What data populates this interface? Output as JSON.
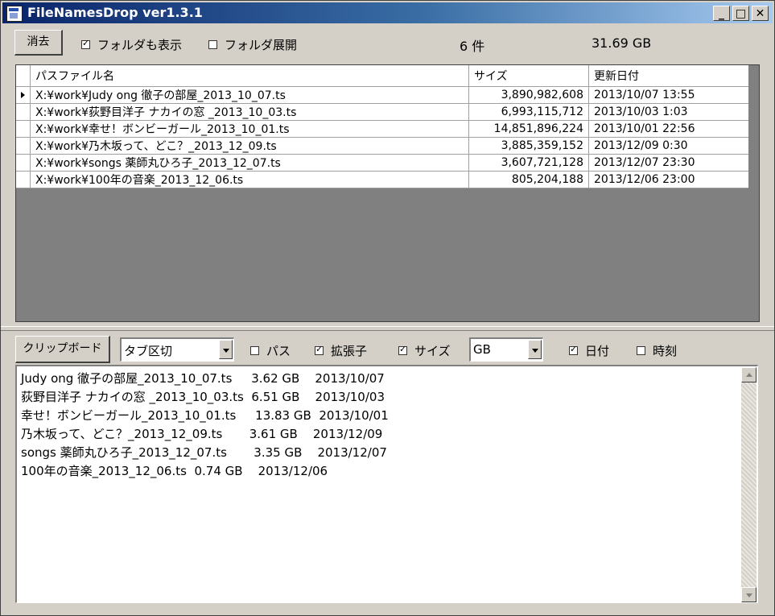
{
  "window": {
    "title": "FileNamesDrop ver1.3.1",
    "minimize": "_",
    "maximize": "□",
    "close": "✕"
  },
  "toolbar": {
    "clear_label": "消去",
    "show_folders_label": "フォルダも表示",
    "show_folders_checked": true,
    "expand_folders_label": "フォルダ展開",
    "expand_folders_checked": false,
    "count": "6 件",
    "total_size": "31.69 GB"
  },
  "grid": {
    "columns": [
      "パスファイル名",
      "サイズ",
      "更新日付"
    ],
    "rows": [
      {
        "path": "X:¥work¥Judy ong 徹子の部屋_2013_10_07.ts",
        "size": "3,890,982,608",
        "date": "2013/10/07 13:55",
        "current": true
      },
      {
        "path": "X:¥work¥荻野目洋子 ナカイの窓 _2013_10_03.ts",
        "size": "6,993,115,712",
        "date": "2013/10/03 1:03",
        "current": false
      },
      {
        "path": "X:¥work¥幸せ！ボンビーガール_2013_10_01.ts",
        "size": "14,851,896,224",
        "date": "2013/10/01 22:56",
        "current": false
      },
      {
        "path": "X:¥work¥乃木坂って、どこ？_2013_12_09.ts",
        "size": "3,885,359,152",
        "date": "2013/12/09 0:30",
        "current": false
      },
      {
        "path": "X:¥work¥songs 薬師丸ひろ子_2013_12_07.ts",
        "size": "3,607,721,128",
        "date": "2013/12/07 23:30",
        "current": false
      },
      {
        "path": "X:¥work¥100年の音楽_2013_12_06.ts",
        "size": "805,204,188",
        "date": "2013/12/06 23:00",
        "current": false
      }
    ]
  },
  "options": {
    "clipboard_label": "クリップボード",
    "separator_value": "タブ区切",
    "path_label": "パス",
    "path_checked": false,
    "ext_label": "拡張子",
    "ext_checked": true,
    "size_label": "サイズ",
    "size_checked": true,
    "unit_value": "GB",
    "date_label": "日付",
    "date_checked": true,
    "time_label": "時刻",
    "time_checked": false
  },
  "output": {
    "lines": [
      "Judy ong 徹子の部屋_2013_10_07.ts     3.62 GB    2013/10/07",
      "荻野目洋子 ナカイの窓 _2013_10_03.ts  6.51 GB    2013/10/03",
      "幸せ！ボンビーガール_2013_10_01.ts     13.83 GB  2013/10/01",
      "乃木坂って、どこ？_2013_12_09.ts       3.61 GB    2013/12/09",
      "songs 薬師丸ひろ子_2013_12_07.ts       3.35 GB    2013/12/07",
      "100年の音楽_2013_12_06.ts  0.74 GB    2013/12/06"
    ]
  }
}
